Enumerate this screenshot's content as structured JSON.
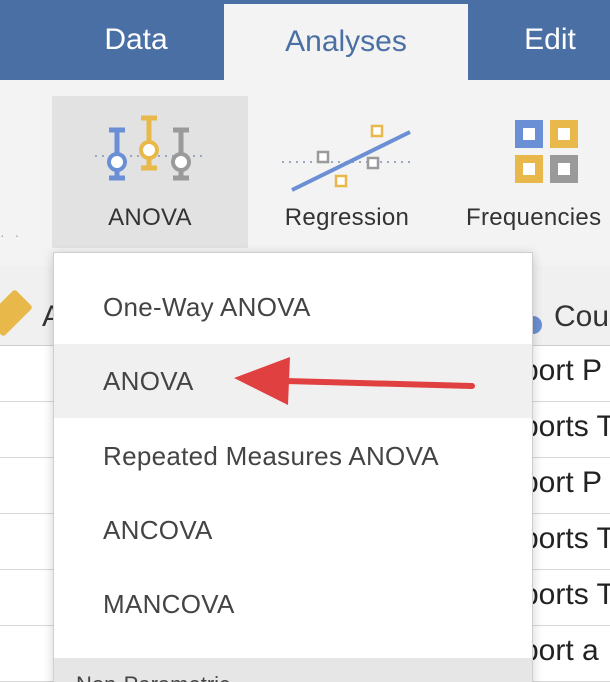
{
  "tabs": [
    {
      "label": "Data"
    },
    {
      "label": "Analyses"
    },
    {
      "label": "Edit"
    }
  ],
  "ribbon": {
    "anova_label": "ANOVA",
    "regression_label": "Regression",
    "frequencies_label": "Frequencies"
  },
  "grid": {
    "col_a_label": "A",
    "col_b_label": "Cou",
    "rows": [
      "port P",
      "ports T",
      "port P",
      "ports T",
      "ports T",
      "port a"
    ]
  },
  "menu": {
    "items": [
      "One-Way ANOVA",
      "ANOVA",
      "Repeated Measures ANOVA",
      "ANCOVA",
      "MANCOVA"
    ],
    "highlighted": "ANOVA",
    "section": "Non-Parametric"
  },
  "colors": {
    "tabbar": "#4a6fa5",
    "ribbon_bg": "#f3f3f3",
    "arrow": "#e04040",
    "icon_blue": "#6a8fd4",
    "icon_orange": "#e8b94a",
    "icon_gray": "#9a9a9a"
  }
}
